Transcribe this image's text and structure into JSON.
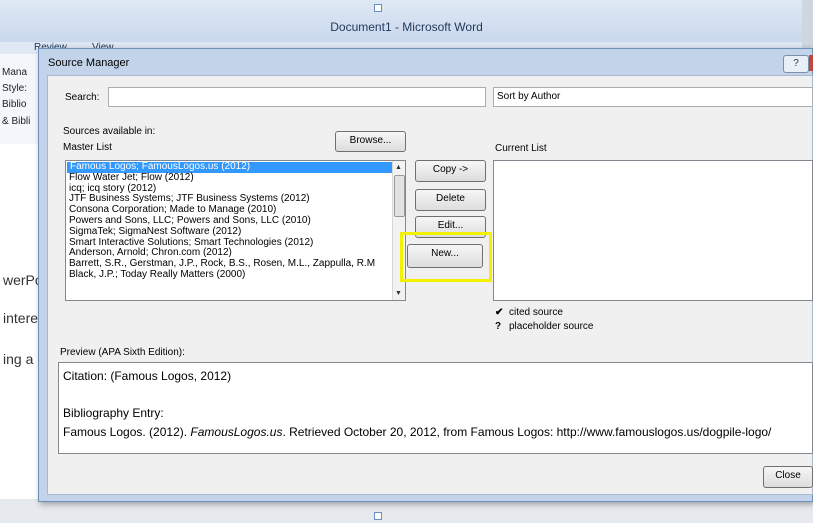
{
  "word": {
    "title": "Document1  -  Microsoft Word",
    "tabs": [
      "Review",
      "View"
    ],
    "side_items": [
      "Mana",
      "Style:",
      "Biblio",
      "& Bibli"
    ],
    "doc_fragments": [
      "werPo",
      "intere",
      "ing a m"
    ]
  },
  "dialog": {
    "title": "Source Manager",
    "help_label": "?",
    "search_label": "Search:",
    "search_value": "",
    "sort_value": "Sort by Author",
    "sources_label": "Sources available in:",
    "master_list_label": "Master List",
    "browse_label": "Browse...",
    "current_list_label": "Current List",
    "master_list": [
      "Famous Logos; FamousLogos.us (2012)",
      "Flow Water Jet; Flow (2012)",
      "icq; icq story (2012)",
      "JTF Business Systems; JTF Business Systems (2012)",
      "Consona Corporation; Made to Manage (2010)",
      "Powers and Sons, LLC; Powers and Sons, LLC (2010)",
      "SigmaTek; SigmaNest Software (2012)",
      "Smart Interactive Solutions; Smart Technologies (2012)",
      "Anderson, Arnold; Chron.com (2012)",
      "Barrett, S.R., Gerstman, J.P., Rock, B.S., Rosen, M.L., Zappulla, R.M",
      "Black, J.P.; Today Really Matters (2000)"
    ],
    "buttons": {
      "copy": "Copy ->",
      "delete": "Delete",
      "edit": "Edit...",
      "new": "New...",
      "close": "Close"
    },
    "legend": [
      {
        "symbol": "✔",
        "text": "cited source"
      },
      {
        "symbol": "?",
        "text": "placeholder source"
      }
    ],
    "preview_label": "Preview (APA Sixth Edition):",
    "preview": {
      "citation": "Citation:  (Famous Logos, 2012)",
      "bib_heading": "Bibliography Entry:",
      "bib_prefix": "Famous Logos. (2012). ",
      "bib_title": "FamousLogos.us",
      "bib_suffix": ". Retrieved October 20, 2012,  from Famous Logos: http://www.famouslogos.us/dogpile-logo/"
    },
    "highlight_color": "#f2f200",
    "selection_color": "#3399ff"
  }
}
